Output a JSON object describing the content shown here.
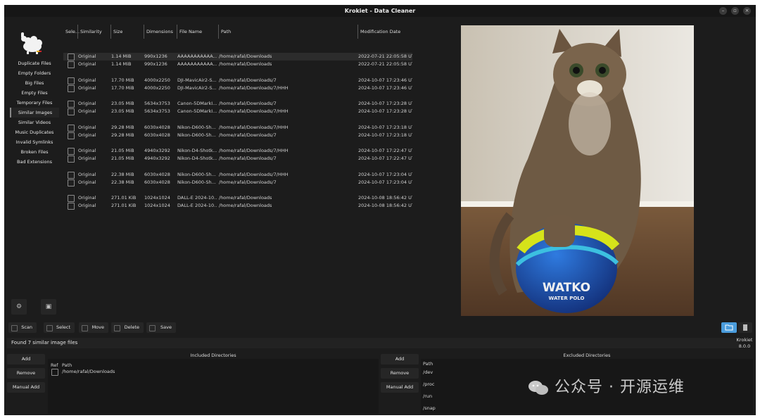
{
  "window": {
    "title": "Krokiet - Data Cleaner"
  },
  "sidebar": {
    "items": [
      {
        "label": "Duplicate Files"
      },
      {
        "label": "Empty Folders"
      },
      {
        "label": "Big Files"
      },
      {
        "label": "Empty Files"
      },
      {
        "label": "Temporary Files"
      },
      {
        "label": "Similar Images"
      },
      {
        "label": "Similar Videos"
      },
      {
        "label": "Music Duplicates"
      },
      {
        "label": "Invalid Symlinks"
      },
      {
        "label": "Broken Files"
      },
      {
        "label": "Bad Extensions"
      }
    ],
    "active": "Similar Images"
  },
  "table": {
    "headers": {
      "select": "Sele...",
      "similarity": "Similarity",
      "size": "Size",
      "dimensions": "Dimensions",
      "filename": "File Name",
      "path": "Path",
      "modified": "Modification Date"
    },
    "rows": [
      {
        "similarity": "Original",
        "size": "1.14 MiB",
        "dimensions": "990x1236",
        "filename": "AAAAAAAAAAA...",
        "path": "/home/rafal/Downloads",
        "modified": "2022-07-21 22:05:58 UT",
        "selected": true
      },
      {
        "similarity": "Original",
        "size": "1.14 MiB",
        "dimensions": "990x1236",
        "filename": "AAAAAAAAAAA...",
        "path": "/home/rafal/Downloads",
        "modified": "2022-07-21 22:05:58 UT"
      },
      {
        "similarity": "Original",
        "size": "17.70 MiB",
        "dimensions": "4000x2250",
        "filename": "DJI-MavicAir2-S...",
        "path": "/home/rafal/Downloads/7",
        "modified": "2024-10-07 17:23:46 UT"
      },
      {
        "similarity": "Original",
        "size": "17.70 MiB",
        "dimensions": "4000x2250",
        "filename": "DJI-MavicAir2-S...",
        "path": "/home/rafal/Downloads/7/HHH",
        "modified": "2024-10-07 17:23:46 UT"
      },
      {
        "similarity": "Original",
        "size": "23.05 MiB",
        "dimensions": "5634x3753",
        "filename": "Canon-5DMarkI...",
        "path": "/home/rafal/Downloads/7",
        "modified": "2024-10-07 17:23:28 UT"
      },
      {
        "similarity": "Original",
        "size": "23.05 MiB",
        "dimensions": "5634x3753",
        "filename": "Canon-5DMarkI...",
        "path": "/home/rafal/Downloads/7/HHH",
        "modified": "2024-10-07 17:23:28 UT"
      },
      {
        "similarity": "Original",
        "size": "29.28 MiB",
        "dimensions": "6030x4028",
        "filename": "Nikon-D600-Sh...",
        "path": "/home/rafal/Downloads/7/HHH",
        "modified": "2024-10-07 17:23:18 UT"
      },
      {
        "similarity": "Original",
        "size": "29.28 MiB",
        "dimensions": "6030x4028",
        "filename": "Nikon-D600-Sh...",
        "path": "/home/rafal/Downloads/7",
        "modified": "2024-10-07 17:23:18 UT"
      },
      {
        "similarity": "Original",
        "size": "21.05 MiB",
        "dimensions": "4940x3292",
        "filename": "Nikon-D4-Shotk...",
        "path": "/home/rafal/Downloads/7/HHH",
        "modified": "2024-10-07 17:22:47 UT"
      },
      {
        "similarity": "Original",
        "size": "21.05 MiB",
        "dimensions": "4940x3292",
        "filename": "Nikon-D4-Shotk...",
        "path": "/home/rafal/Downloads/7",
        "modified": "2024-10-07 17:22:47 UT"
      },
      {
        "similarity": "Original",
        "size": "22.38 MiB",
        "dimensions": "6030x4028",
        "filename": "Nikon-D600-Sh...",
        "path": "/home/rafal/Downloads/7/HHH",
        "modified": "2024-10-07 17:23:04 UT"
      },
      {
        "similarity": "Original",
        "size": "22.38 MiB",
        "dimensions": "6030x4028",
        "filename": "Nikon-D600-Sh...",
        "path": "/home/rafal/Downloads/7",
        "modified": "2024-10-07 17:23:04 UT"
      },
      {
        "similarity": "Original",
        "size": "271.01 KiB",
        "dimensions": "1024x1024",
        "filename": "DALL-E 2024-10...",
        "path": "/home/rafal/Downloads",
        "modified": "2024-10-08 18:56:42 UT"
      },
      {
        "similarity": "Original",
        "size": "271.01 KiB",
        "dimensions": "1024x1024",
        "filename": "DALL-E 2024-10...",
        "path": "/home/rafal/Downloads",
        "modified": "2024-10-08 18:56:42 UT"
      }
    ]
  },
  "preview": {
    "ball_text": "WATKO",
    "ball_subtext": "WATER POLO"
  },
  "toolbar": {
    "scan": "Scan",
    "select": "Select",
    "move": "Move",
    "delete": "Delete",
    "save": "Save"
  },
  "status": {
    "text": "Found 7 similar image files"
  },
  "version": {
    "name": "Krokiet",
    "number": "8.0.0"
  },
  "included": {
    "title": "Included Directories",
    "add": "Add",
    "remove": "Remove",
    "manual_add": "Manual Add",
    "ref_header": "Ref",
    "path_header": "Path",
    "paths": [
      "/home/rafal/Downloads"
    ]
  },
  "excluded": {
    "title": "Excluded Directories",
    "add": "Add",
    "remove": "Remove",
    "manual_add": "Manual Add",
    "path_header": "Path",
    "paths": [
      "/dev",
      "/proc",
      "/run",
      "/snap"
    ]
  },
  "watermark": {
    "text": "公众号 · 开源运维"
  },
  "colors": {
    "accent": "#4a9cdc",
    "background": "#1c1c1c"
  }
}
